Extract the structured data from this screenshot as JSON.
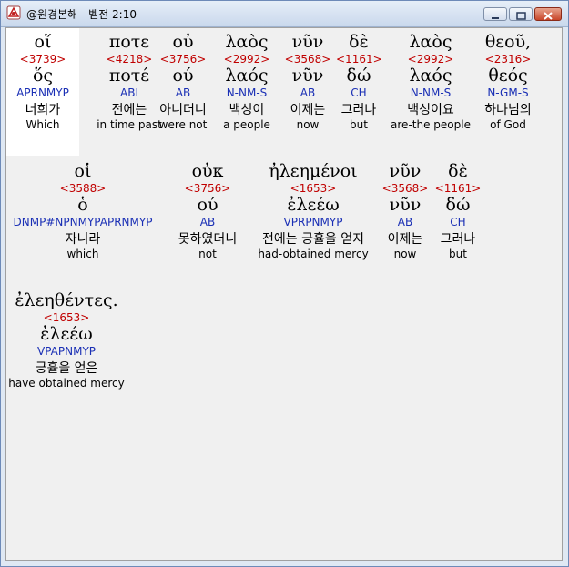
{
  "window": {
    "title": "@원경본해 - 벧전 2:10"
  },
  "rows": [
    [
      {
        "greek": "οἵ",
        "strong": "<3739>",
        "lemma": "ὅς",
        "parse": "APRNMYP",
        "korean": "너희가",
        "english": "Which",
        "hl": true
      },
      {
        "greek": "ποτε",
        "strong": "<4218>",
        "lemma": "ποτέ",
        "parse": "ABI",
        "korean": "전에는",
        "english": "in time past"
      },
      {
        "greek": "οὐ",
        "strong": "<3756>",
        "lemma": "ού",
        "parse": "AB",
        "korean": "아니더니",
        "english": "were not"
      },
      {
        "greek": "λαὸς",
        "strong": "<2992>",
        "lemma": "λαός",
        "parse": "N-NM-S",
        "korean": "백성이",
        "english": "a people"
      },
      {
        "greek": "νῦν",
        "strong": "<3568>",
        "lemma": "νῦν",
        "parse": "AB",
        "korean": "이제는",
        "english": "now"
      },
      {
        "greek": "δὲ",
        "strong": "<1161>",
        "lemma": "δώ",
        "parse": "CH",
        "korean": "그러나",
        "english": "but"
      },
      {
        "greek": "λαὸς",
        "strong": "<2992>",
        "lemma": "λαός",
        "parse": "N-NM-S",
        "korean": "백성이요",
        "english": "are-the people"
      },
      {
        "greek": "θεοῦ,",
        "strong": "<2316>",
        "lemma": "θεός",
        "parse": "N-GM-S",
        "korean": "하나님의",
        "english": "of God"
      }
    ],
    [
      {
        "greek": "οἱ",
        "strong": "<3588>",
        "lemma": "ὁ",
        "parse": "DNMP#NPNMYPAPRNMYP",
        "korean": "자니라",
        "english": "which"
      },
      {
        "greek": "οὐκ",
        "strong": "<3756>",
        "lemma": "ού",
        "parse": "AB",
        "korean": "못하였더니",
        "english": "not"
      },
      {
        "greek": "ἠλεημένοι",
        "strong": "<1653>",
        "lemma": "ἐλεέω",
        "parse": "VPRPNMYP",
        "korean": "전에는 긍휼을 얻지",
        "english": "had-obtained mercy"
      },
      {
        "greek": "νῦν",
        "strong": "<3568>",
        "lemma": "νῦν",
        "parse": "AB",
        "korean": "이제는",
        "english": "now"
      },
      {
        "greek": "δὲ",
        "strong": "<1161>",
        "lemma": "δώ",
        "parse": "CH",
        "korean": "그러나",
        "english": "but"
      }
    ],
    [
      {
        "greek": "ἐλεηθέντες.",
        "strong": "<1653>",
        "lemma": "ἐλεέω",
        "parse": "VPAPNMYP",
        "korean": "긍휼을 얻은",
        "english": "have obtained mercy"
      }
    ]
  ]
}
